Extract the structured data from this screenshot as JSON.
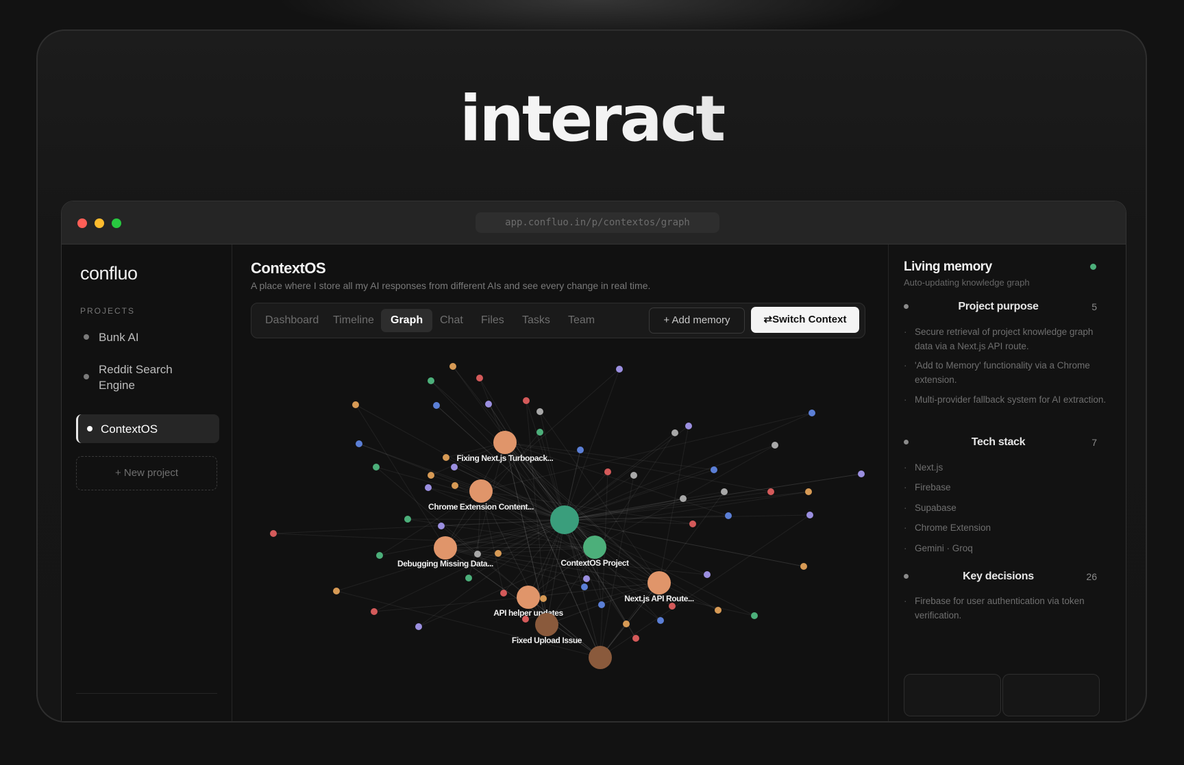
{
  "hero": {
    "title": "interact"
  },
  "browser": {
    "url": "app.confluo.in/p/contextos/graph"
  },
  "sidebar": {
    "logo": "confluo",
    "projects_heading": "PROJECTS",
    "projects": [
      {
        "label": "Bunk AI"
      },
      {
        "label": "Reddit Search Engine"
      },
      {
        "label": "ContextOS",
        "active": true
      }
    ],
    "new_project": "+ New project"
  },
  "main": {
    "title": "ContextOS",
    "subtitle": "A place where I store all my AI responses from different AIs and see every change in real time.",
    "tabs": [
      "Dashboard",
      "Timeline",
      "Graph",
      "Chat",
      "Files",
      "Tasks",
      "Team"
    ],
    "active_tab": "Graph",
    "add_memory": "+ Add memory",
    "switch_context": "⇄Switch Context"
  },
  "graph": {
    "labels": {
      "n1": "Fixing Next.js Turbopack...",
      "n2": "Chrome Extension Content...",
      "n3": "Debugging Missing Data...",
      "n4": "ContextOS Project",
      "n5": "Next.js API Route...",
      "n6": "API helper updates",
      "n7": "Fixed Upload Issue"
    },
    "colors": {
      "orange": "#e0956a",
      "green": "#4caf7a",
      "center": "#3a9e7c",
      "red": "#d45a5a",
      "purple": "#9b8fe0",
      "blue": "#5b7fd6",
      "gray": "#a8a8a8",
      "amber": "#d79a55",
      "brown": "#8a5a3c"
    }
  },
  "right_panel": {
    "title": "Living memory",
    "subtitle": "Auto-updating knowledge graph",
    "sections": [
      {
        "title": "Project purpose",
        "count": "5",
        "items": [
          "Secure retrieval of project knowledge graph data via a Next.js API route.",
          "'Add to Memory' functionality via a Chrome extension.",
          "Multi-provider fallback system for AI extraction."
        ]
      },
      {
        "title": "Tech stack",
        "count": "7",
        "items": [
          "Next.js",
          "Firebase",
          "Supabase",
          "Chrome Extension",
          "Gemini · Groq"
        ]
      },
      {
        "title": "Key decisions",
        "count": "26",
        "items": [
          "Firebase for user authentication via token verification."
        ]
      }
    ]
  }
}
